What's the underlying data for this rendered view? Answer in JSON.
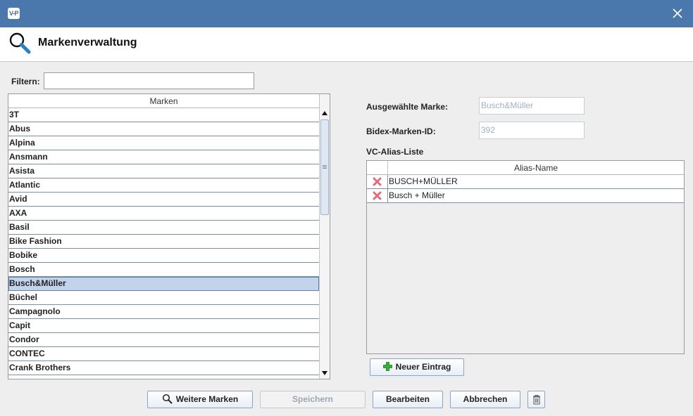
{
  "window": {
    "app_icon_text": "V-P",
    "header_title": "Markenverwaltung",
    "colors": {
      "titlebar": "#4a78ad",
      "selection": "#c3d3ea",
      "button_border": "#8aa3c6",
      "delete_icon": "#e06e7a",
      "add_icon": "#2eaa2e"
    }
  },
  "filter": {
    "label": "Filtern:",
    "value": ""
  },
  "brands": {
    "column_header": "Marken",
    "selected": "Busch&Müller",
    "items": [
      "3T",
      "Abus",
      "Alpina",
      "Ansmann",
      "Asista",
      "Atlantic",
      "Avid",
      "AXA",
      "Basil",
      "Bike Fashion",
      "Bobike",
      "Bosch",
      "Busch&Müller",
      "Büchel",
      "Campagnolo",
      "Capit",
      "Condor",
      "CONTEC",
      "Crank Brothers"
    ]
  },
  "details": {
    "selected_brand_label": "Ausgewählte Marke:",
    "selected_brand_value": "Busch&Müller",
    "bidex_id_label": "Bidex-Marken-ID:",
    "bidex_id_value": "392",
    "alias_list_label": "VC-Alias-Liste"
  },
  "alias_table": {
    "column_header": "Alias-Name",
    "rows": [
      "BUSCH+MÜLLER",
      "Busch + Müller"
    ]
  },
  "buttons": {
    "new_entry": "Neuer Eintrag",
    "more_brands": "Weitere Marken",
    "save": "Speichern",
    "edit": "Bearbeiten",
    "cancel": "Abbrechen"
  },
  "icons": [
    "app-icon",
    "close-icon",
    "magnifier-icon",
    "scroll-up-arrow-icon",
    "scroll-down-arrow-icon",
    "delete-x-icon",
    "plus-icon",
    "search-icon",
    "trash-icon"
  ]
}
